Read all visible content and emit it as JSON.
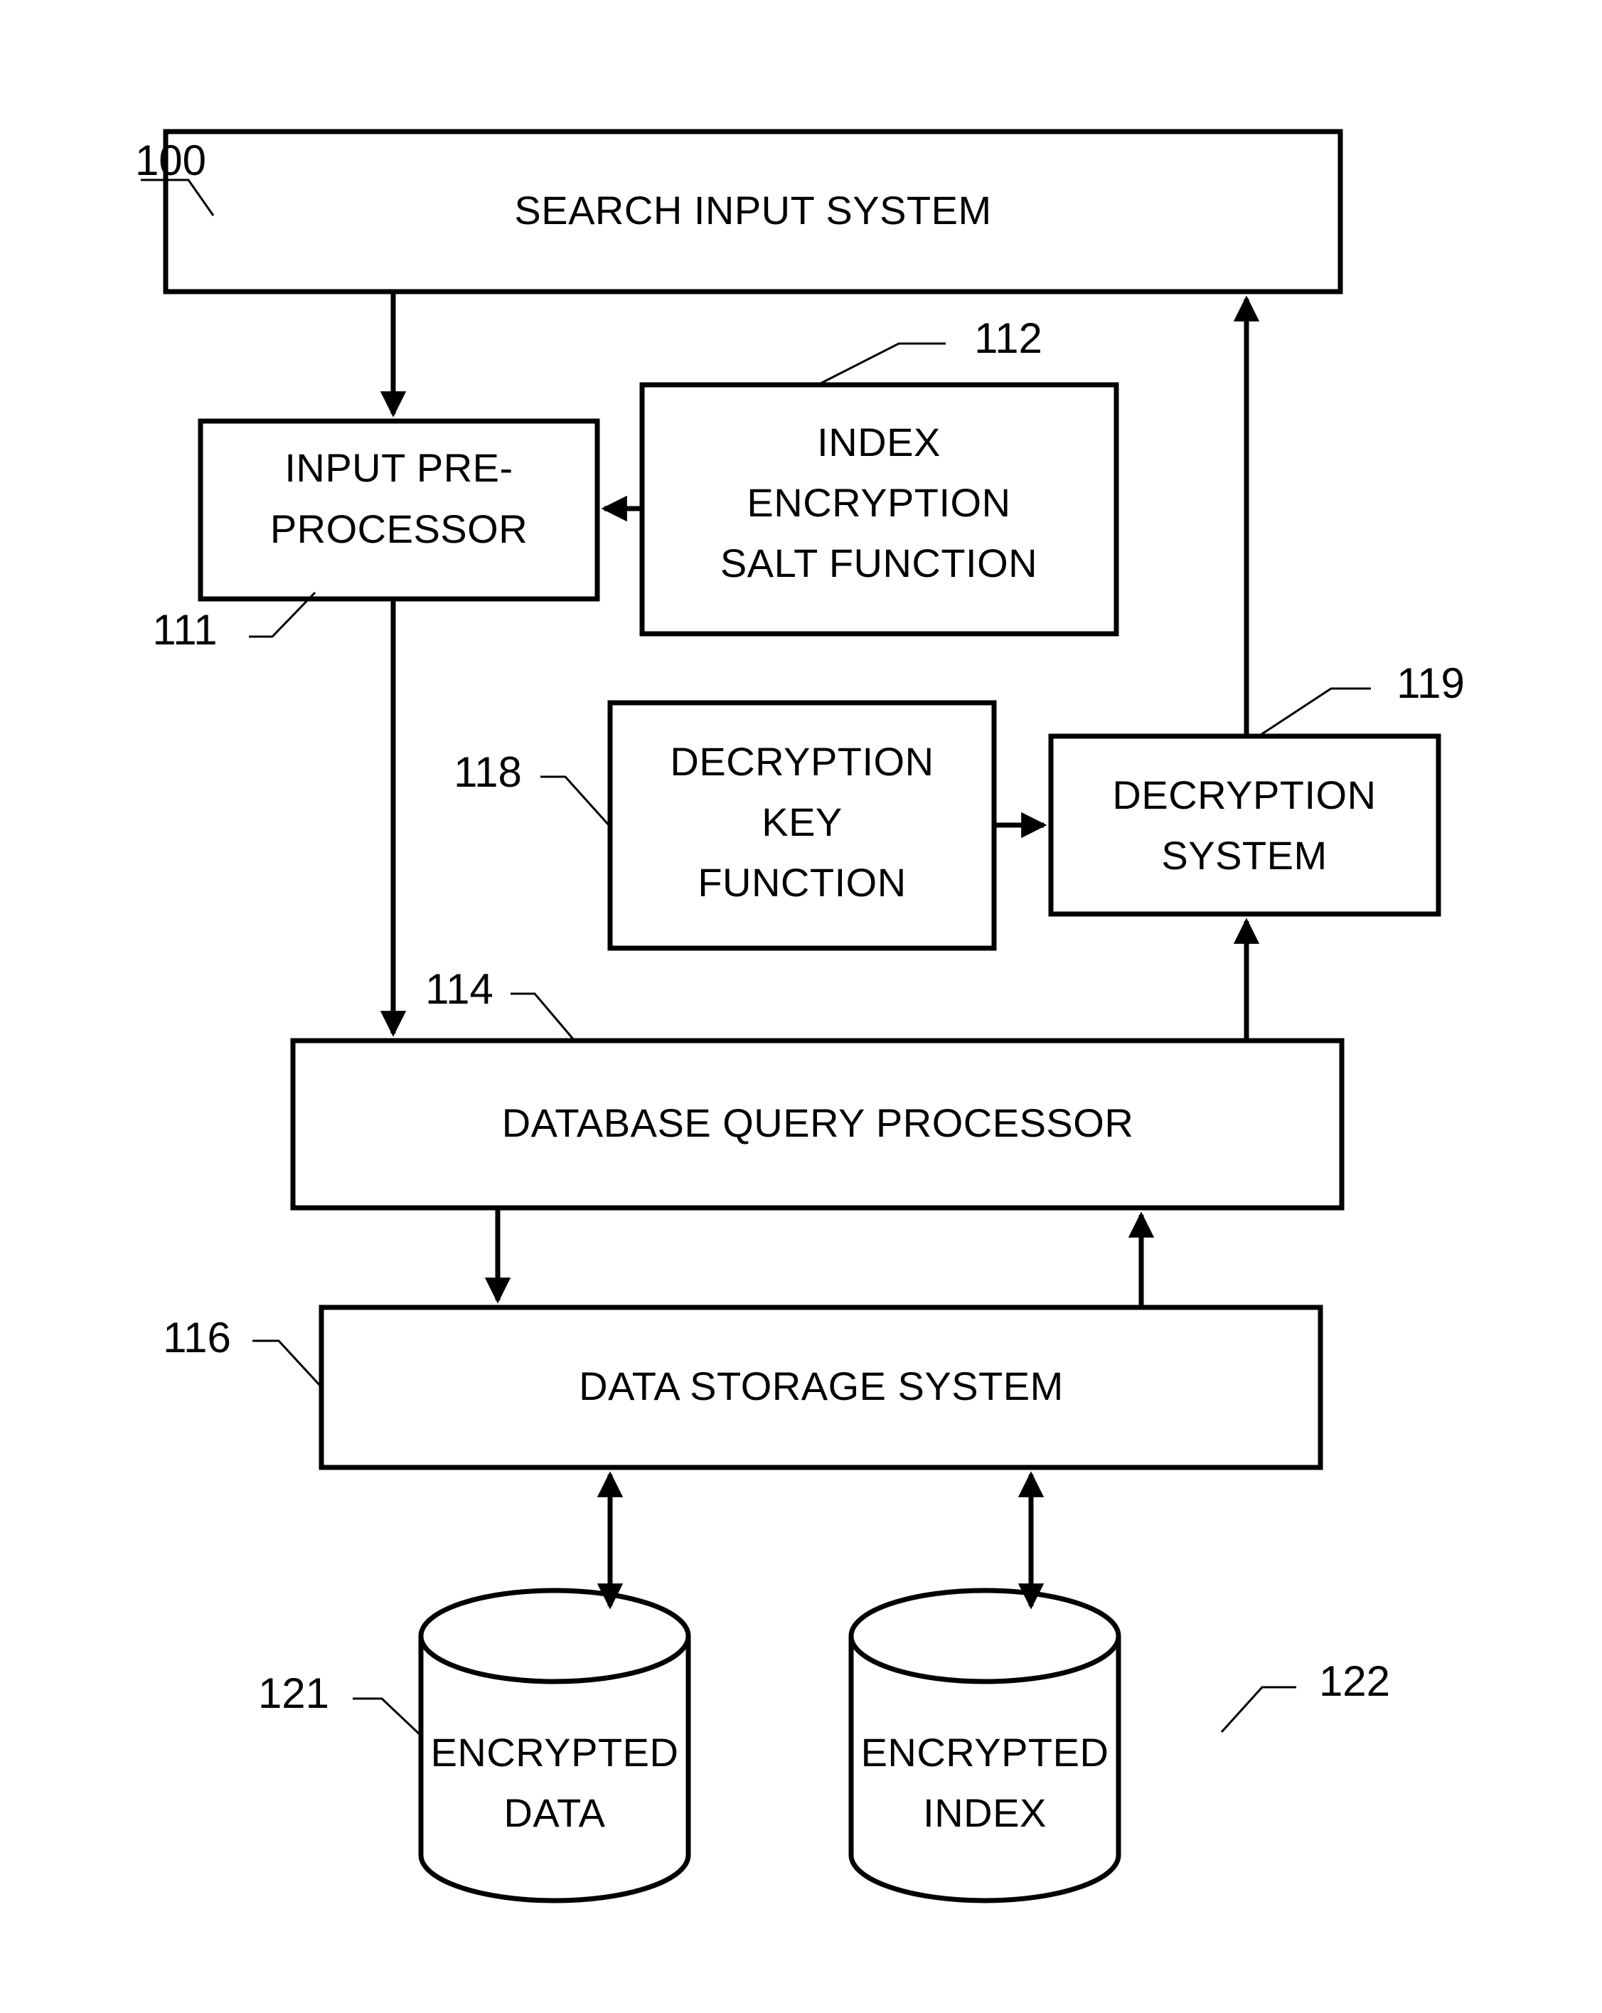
{
  "figure": {
    "title": "Encrypted search system block diagram",
    "line_color": "#000000",
    "background_color": "#ffffff"
  },
  "blocks": {
    "search_input_system": {
      "label": "SEARCH INPUT SYSTEM",
      "ref": "100"
    },
    "input_pre_processor": {
      "line1": "INPUT PRE-",
      "line2": "PROCESSOR",
      "ref": "111"
    },
    "index_encryption_salt_function": {
      "line1": "INDEX",
      "line2": "ENCRYPTION",
      "line3": "SALT FUNCTION",
      "ref": "112"
    },
    "decryption_key_function": {
      "line1": "DECRYPTION",
      "line2": "KEY",
      "line3": "FUNCTION",
      "ref": "118"
    },
    "decryption_system": {
      "line1": "DECRYPTION",
      "line2": "SYSTEM",
      "ref": "119"
    },
    "database_query_processor": {
      "label": "DATABASE QUERY PROCESSOR",
      "ref": "114"
    },
    "data_storage_system": {
      "label": "DATA STORAGE SYSTEM",
      "ref": "116"
    },
    "encrypted_data_store": {
      "line1": "ENCRYPTED",
      "line2": "DATA",
      "ref": "121"
    },
    "encrypted_index_store": {
      "line1": "ENCRYPTED",
      "line2": "INDEX",
      "ref": "122"
    }
  },
  "connectors": [
    {
      "name": "search-input-to-preprocessor",
      "from": "search_input_system",
      "to": "input_pre_processor",
      "direction": "down",
      "arrowheads": 1
    },
    {
      "name": "salt-function-to-preprocessor",
      "from": "index_encryption_salt_function",
      "to": "input_pre_processor",
      "direction": "left",
      "arrowheads": 1
    },
    {
      "name": "preprocessor-to-query-processor",
      "from": "input_pre_processor",
      "to": "database_query_processor",
      "direction": "down",
      "arrowheads": 1
    },
    {
      "name": "key-function-to-decryption-system",
      "from": "decryption_key_function",
      "to": "decryption_system",
      "direction": "right",
      "arrowheads": 1
    },
    {
      "name": "decryption-system-to-search-input",
      "from": "decryption_system",
      "to": "search_input_system",
      "direction": "up",
      "arrowheads": 1
    },
    {
      "name": "query-processor-to-decryption-system",
      "from": "database_query_processor",
      "to": "decryption_system",
      "direction": "up",
      "arrowheads": 1
    },
    {
      "name": "query-processor-to-data-storage",
      "from": "database_query_processor",
      "to": "data_storage_system",
      "direction": "down",
      "arrowheads": 1
    },
    {
      "name": "data-storage-to-query-processor",
      "from": "data_storage_system",
      "to": "database_query_processor",
      "direction": "up",
      "arrowheads": 1
    },
    {
      "name": "data-storage-to-encrypted-data",
      "from": "data_storage_system",
      "to": "encrypted_data_store",
      "direction": "bidirectional",
      "arrowheads": 2
    },
    {
      "name": "data-storage-to-encrypted-index",
      "from": "data_storage_system",
      "to": "encrypted_index_store",
      "direction": "bidirectional",
      "arrowheads": 2
    }
  ]
}
